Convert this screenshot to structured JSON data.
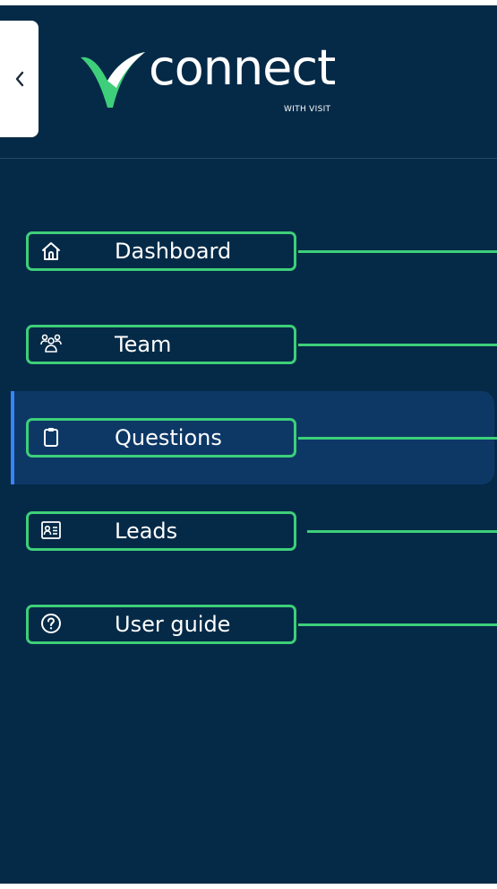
{
  "app": {
    "logo_word": "connect",
    "logo_sub": "WITH VISIT"
  },
  "nav": {
    "items": [
      {
        "label": "Dashboard",
        "icon": "home-icon",
        "active": false
      },
      {
        "label": "Team",
        "icon": "team-icon",
        "active": false
      },
      {
        "label": "Questions",
        "icon": "clipboard-icon",
        "active": true
      },
      {
        "label": "Leads",
        "icon": "contact-card-icon",
        "active": false
      },
      {
        "label": "User guide",
        "icon": "help-circle-icon",
        "active": false
      }
    ]
  },
  "colors": {
    "sidebar_bg": "#052a47",
    "active_bg": "#0d3866",
    "active_indicator": "#3b82f6",
    "highlight": "#3ecf7a",
    "logo_mark": "#3ecf7a"
  }
}
